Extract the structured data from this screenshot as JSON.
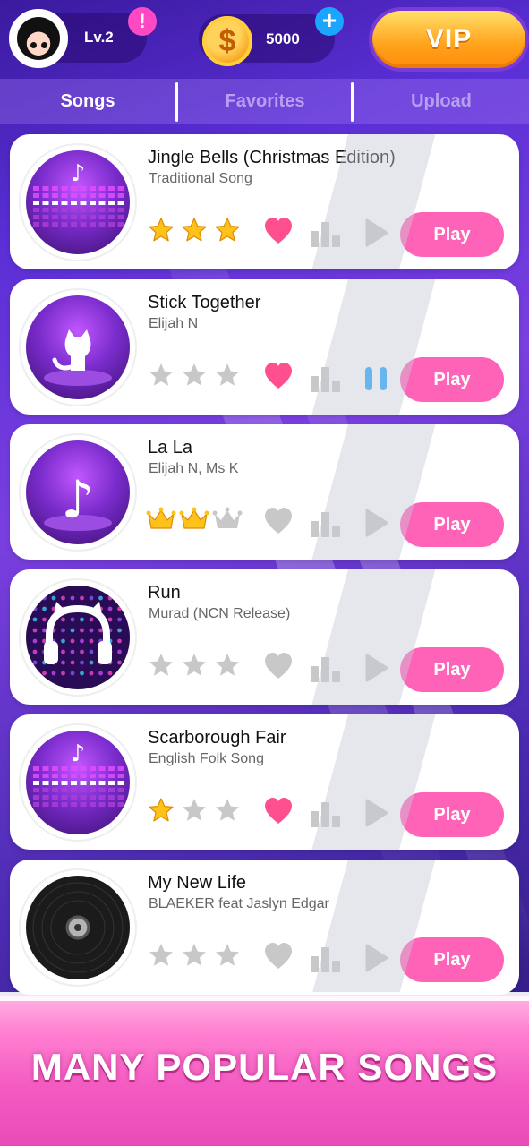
{
  "header": {
    "level": "Lv.2",
    "alert_glyph": "!",
    "coins": "5000",
    "coin_glyph": "$",
    "plus_glyph": "+",
    "vip": "VIP"
  },
  "tabs": [
    {
      "label": "Songs",
      "active": true
    },
    {
      "label": "Favorites",
      "active": false
    },
    {
      "label": "Upload",
      "active": false
    }
  ],
  "songs": [
    {
      "title": "Jingle Bells (Christmas Edition)",
      "artist": "Traditional Song",
      "thumb": "equalizer-music-note",
      "rating_icon": "star",
      "rating": 3,
      "favorite": true,
      "status": "play-icon",
      "play_label": "Play"
    },
    {
      "title": "Stick Together",
      "artist": "Elijah N",
      "thumb": "cat-spotlight",
      "rating_icon": "star",
      "rating": 0,
      "favorite": true,
      "status": "pause-icon",
      "play_label": "Play"
    },
    {
      "title": "La La",
      "artist": "Elijah N, Ms K",
      "thumb": "music-note-spotlight",
      "rating_icon": "crown",
      "rating": 2,
      "favorite": false,
      "status": "play-icon",
      "play_label": "Play"
    },
    {
      "title": "Run",
      "artist": "Murad (NCN Release)",
      "thumb": "cat-ear-headphones",
      "rating_icon": "star",
      "rating": 0,
      "favorite": false,
      "status": "play-icon",
      "play_label": "Play"
    },
    {
      "title": "Scarborough Fair",
      "artist": "English Folk Song",
      "thumb": "equalizer-music-note",
      "rating_icon": "star",
      "rating": 1,
      "favorite": true,
      "status": "play-icon",
      "play_label": "Play"
    },
    {
      "title": "My New Life",
      "artist": "BLAEKER feat Jaslyn Edgar",
      "thumb": "vinyl-record",
      "rating_icon": "star",
      "rating": 0,
      "favorite": false,
      "status": "play-icon",
      "play_label": "Play"
    }
  ],
  "banner": {
    "text": "MANY POPULAR SONGS"
  },
  "colors": {
    "accent_pink": "#ff63b8",
    "heart_active": "#ff4f8f",
    "icon_inactive": "#c8c8c8",
    "star_gold": "#ffc21a",
    "pause_blue": "#1aa6ff",
    "tab_active": "#ffffff",
    "tab_inactive": "#b89ff0"
  }
}
